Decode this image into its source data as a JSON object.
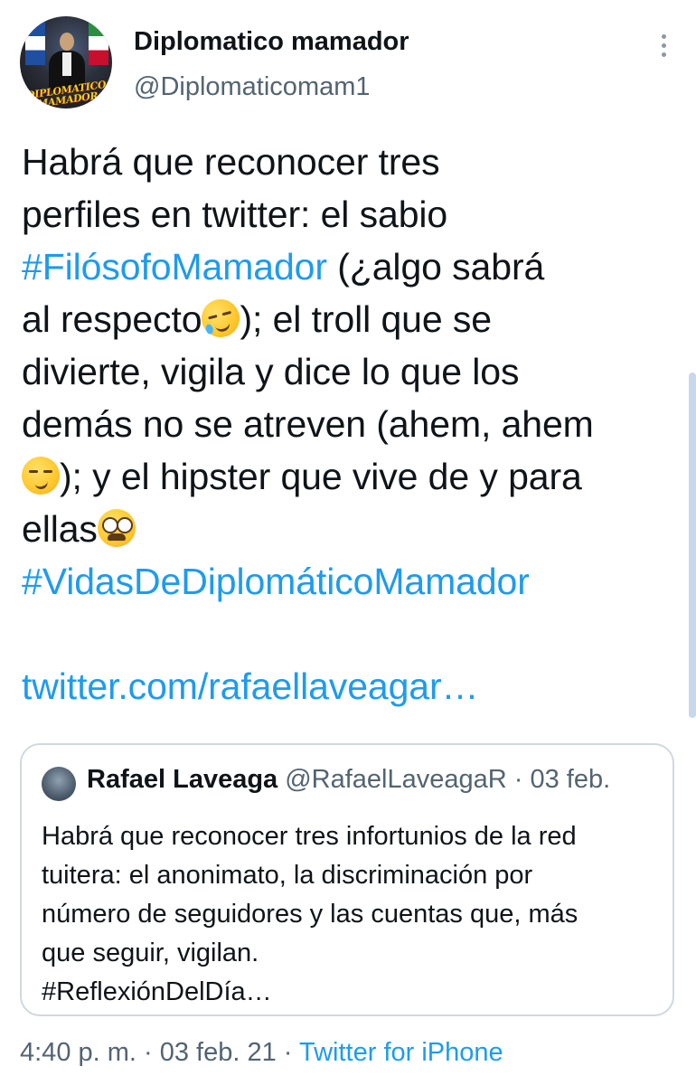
{
  "tweet": {
    "author": {
      "name": "Diplomatico mamador",
      "handle": "@Diplomaticomam1",
      "avatar_text": "DIPLOMATICO MAMADOR"
    },
    "lines": [
      [
        "Habrá que reconocer tres"
      ],
      [
        "perfiles en twitter: el sabio"
      ],
      [
        "#FilósofoMamador",
        " (¿algo sabrá"
      ],
      [
        "al respecto",
        [
          "rolling-on-the-floor-laughing-emoji"
        ],
        "); el troll que se"
      ],
      [
        "divierte, vigila y dice lo que los"
      ],
      [
        "demás no se atreven (ahem, ahem"
      ],
      [
        [
          "smirking-face-emoji"
        ],
        "); y el hipster que vive de y para"
      ],
      [
        "ellas",
        [
          "nerd-face-emoji"
        ]
      ],
      [
        "#VidasDeDiplomáticoMamador"
      ]
    ],
    "hashtag_1": "#FilósofoMamador",
    "hashtag_2": "#VidasDeDiplomáticoMamador",
    "link": "twitter.com/rafaellaveagar…",
    "timestamp": "4:40 p. m. · 03 feb. 21 · ",
    "source": "Twitter for iPhone"
  },
  "text_parts": {
    "l1": "Habrá que reconocer tres",
    "l2": "perfiles en twitter: el sabio",
    "l3b": " (¿algo sabrá",
    "l4a": "al respecto",
    "l4b": "); el troll que se",
    "l5": "divierte, vigila y dice lo que los",
    "l6": "demás no se atreven (ahem, ahem",
    "l7": "); y el hipster que vive de y para",
    "l8": "ellas"
  },
  "quoted": {
    "name": "Rafael Laveaga",
    "meta": " @RafaelLaveagaR · 03 feb.",
    "lines": [
      "Habrá que reconocer tres infortunios de la red",
      "tuitera: el anonimato, la discriminación por",
      "número de seguidores y las cuentas que, más",
      "que seguir, vigilan.",
      "#ReflexiónDelDía…"
    ]
  },
  "icons": {
    "more": "more-vertical-icon",
    "emoji_1": "rolling-on-the-floor-laughing-emoji",
    "emoji_2": "smirking-face-emoji",
    "emoji_3": "nerd-face-emoji"
  },
  "colors": {
    "link": "#1d9bf0",
    "text": "#0f1419",
    "secondary": "#536471",
    "border": "#cfd9de"
  }
}
